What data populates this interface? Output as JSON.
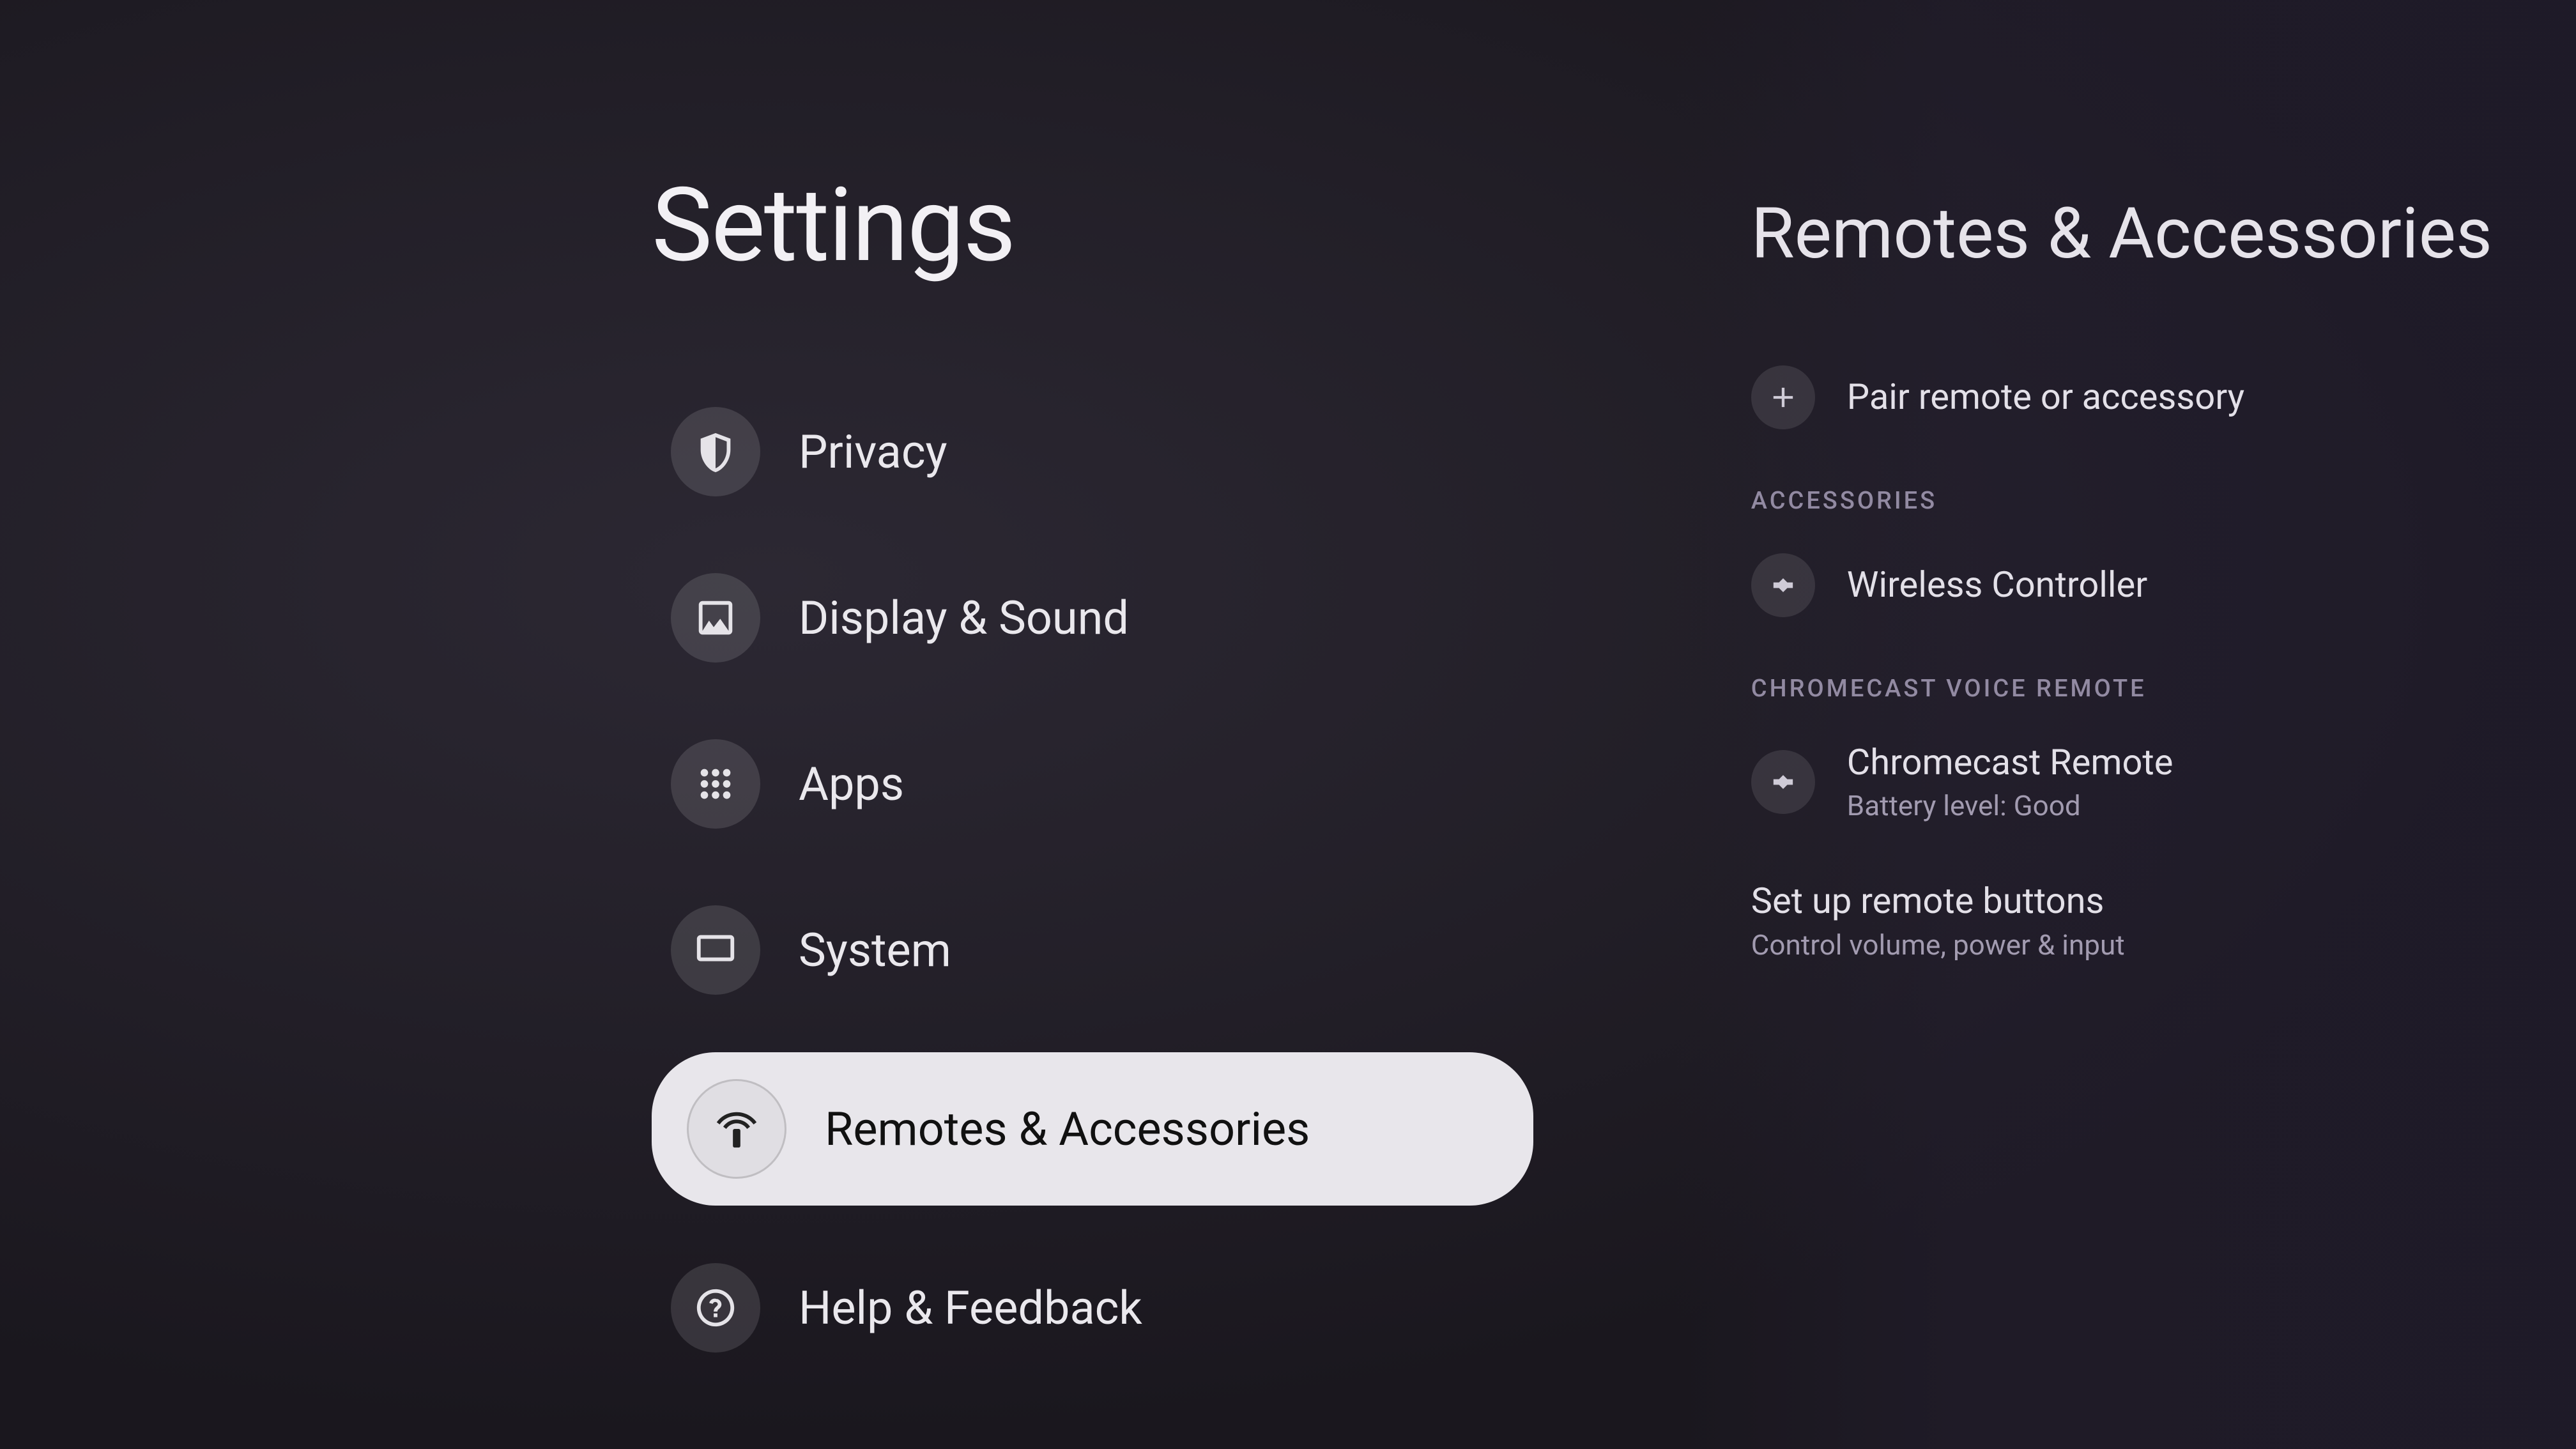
{
  "settings": {
    "title": "Settings",
    "items": [
      {
        "key": "privacy",
        "label": "Privacy",
        "icon": "shield-icon",
        "selected": false
      },
      {
        "key": "display",
        "label": "Display & Sound",
        "icon": "image-icon",
        "selected": false
      },
      {
        "key": "apps",
        "label": "Apps",
        "icon": "apps-icon",
        "selected": false
      },
      {
        "key": "system",
        "label": "System",
        "icon": "monitor-icon",
        "selected": false
      },
      {
        "key": "remotes",
        "label": "Remotes & Accessories",
        "icon": "remote-icon",
        "selected": true
      },
      {
        "key": "help",
        "label": "Help & Feedback",
        "icon": "help-icon",
        "selected": false
      }
    ]
  },
  "detail": {
    "title": "Remotes & Accessories",
    "pair_label": "Pair remote or accessory",
    "sections": [
      {
        "heading": "ACCESSORIES",
        "rows": [
          {
            "icon": "gamepad-icon",
            "primary": "Wireless Controller",
            "secondary": ""
          }
        ]
      },
      {
        "heading": "CHROMECAST VOICE REMOTE",
        "rows": [
          {
            "icon": "gamepad-icon",
            "primary": "Chromecast Remote",
            "secondary": "Battery level: Good"
          }
        ]
      }
    ],
    "setup_primary": "Set up remote buttons",
    "setup_secondary": "Control volume, power & input"
  }
}
